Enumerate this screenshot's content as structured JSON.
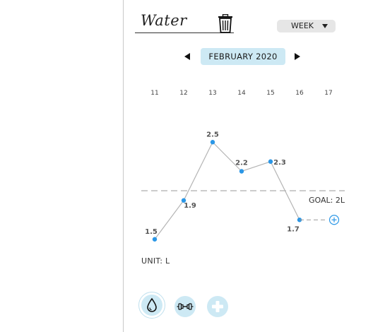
{
  "tracker": {
    "title": "Water",
    "range": "WEEK",
    "month": "FEBRUARY 2020",
    "unit_label": "UNIT: L",
    "goal_label": "GOAL: 2L"
  },
  "colors": {
    "accent": "#2b97e6",
    "chip_bg": "#cde9f4",
    "line": "#b4b4b4",
    "select_bg": "#e6e6e6"
  },
  "icons": {
    "delete": "trash-icon",
    "prev": "triangle-left-icon",
    "next": "triangle-right-icon",
    "add_entry": "plus-circle-icon",
    "nav": [
      "water-drop-icon",
      "dumbbell-icon",
      "plus-icon"
    ]
  },
  "chart_data": {
    "type": "line",
    "x": [
      "11",
      "12",
      "13",
      "14",
      "15",
      "16",
      "17"
    ],
    "values": [
      1.5,
      1.9,
      2.5,
      2.2,
      2.3,
      1.7,
      null
    ],
    "data_labels": [
      "1.5",
      "1.9",
      "2.5",
      "2.2",
      "2.3",
      "1.7",
      ""
    ],
    "goal": 2,
    "ylim": [
      1.2,
      2.8
    ],
    "grid": false
  }
}
